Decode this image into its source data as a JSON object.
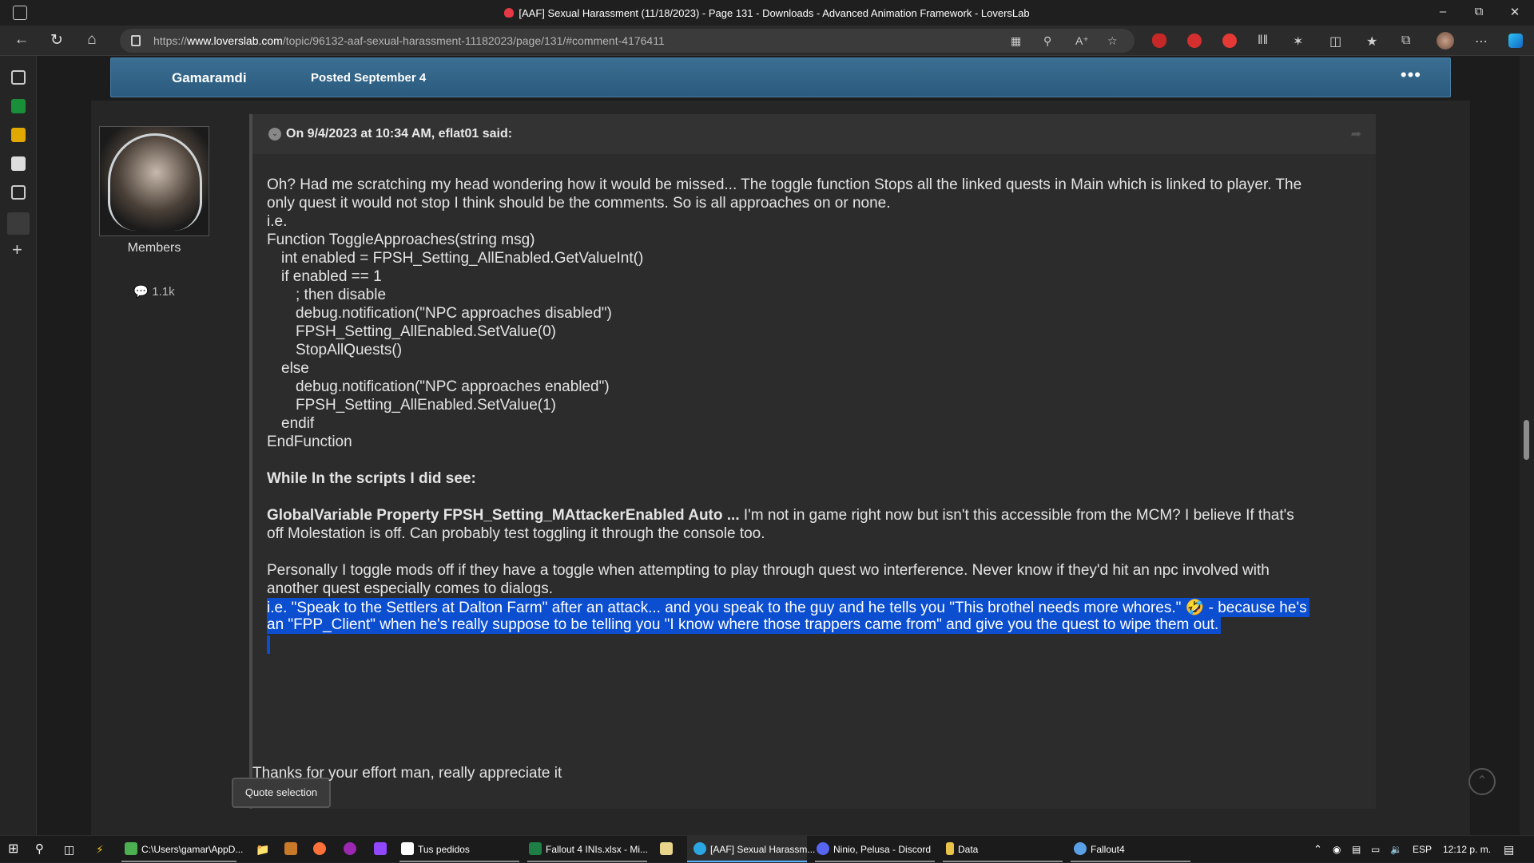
{
  "window": {
    "title": "[AAF] Sexual Harassment (11/18/2023) - Page 131 - Downloads - Advanced Animation Framework - LoversLab"
  },
  "nav": {
    "url_prefix": "https://",
    "url_domain": "www.loverslab.com",
    "url_rest": "/topic/96132-aaf-sexual-harassment-11182023/page/131/#comment-4176411"
  },
  "extensions": [
    "shield-red",
    "abp",
    "red-drop",
    "equalizer"
  ],
  "post": {
    "author": "Gamaramdi",
    "posted": "Posted September 4",
    "group": "Members",
    "post_count": "1.1k",
    "quote_header": "On 9/4/2023 at 10:34 AM, eflat01 said:",
    "lines": [
      "Oh? Had me scratching my head wondering how it would be missed... The toggle function Stops all the linked quests in Main which is linked to player. The",
      "only quest it would not stop I think should be the comments. So is all approaches on or none.",
      "i.e.",
      "Function ToggleApproaches(string msg)",
      "    int enabled = FPSH_Setting_AllEnabled.GetValueInt()",
      "    if enabled == 1",
      "        ; then disable",
      "        debug.notification(\"NPC approaches disabled\")",
      "        FPSH_Setting_AllEnabled.SetValue(0)",
      "        StopAllQuests()",
      "    else",
      "        debug.notification(\"NPC approaches enabled\")",
      "        FPSH_Setting_AllEnabled.SetValue(1)",
      "    endif",
      "EndFunction"
    ],
    "scripts_heading": "While In the scripts I did see:",
    "global_bold": "GlobalVariable Property FPSH_Setting_MAttackerEnabled Auto ...",
    "global_rest": " I'm not in game right now but isn't this accessible from the MCM? I believe If that's",
    "global_line2": "off Molestation is off. Can probably test toggling it through the console too.",
    "personal_line1": "Personally I toggle mods off if they have a toggle when attempting to play through quest wo interference. Never know if they'd hit an npc involved with",
    "personal_line2": "another quest especially comes to dialogs.",
    "hl_line1": "i.e. \"Speak to the Settlers at Dalton Farm\" after an attack... and you speak to the guy and he tells you \"This brothel needs more whores.\" 🤣 - because he's",
    "hl_line2": "an \"FPP_Client\" when he's really suppose to be telling you \"I know where those trappers came from\" and give you the quest to wipe them out.",
    "quote_selection": "Quote selection",
    "thanks": "Thanks for your effort man, really appreciate it"
  },
  "taskbar": {
    "items": [
      {
        "label": "C:\\Users\\gamar\\AppD...",
        "color": "#4caf50"
      },
      {
        "label": "Tus pedidos",
        "color": "#fff"
      },
      {
        "label": "Fallout 4 INIs.xlsx - Mi...",
        "color": "#1e7e45"
      },
      {
        "label": "[AAF] Sexual Harassm...",
        "color": "#2aa7e0"
      },
      {
        "label": "Ninio, Pelusa - Discord",
        "color": "#5865f2"
      },
      {
        "label": "Data",
        "color": "#e9c349"
      },
      {
        "label": "Fallout4",
        "color": "#5aa0e6"
      }
    ],
    "lang": "ESP",
    "time": "12:12 p. m."
  }
}
